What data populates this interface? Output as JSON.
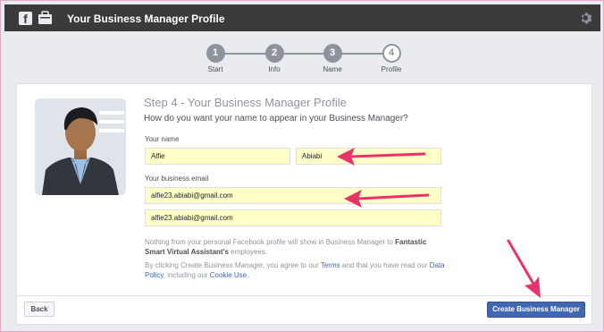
{
  "topbar": {
    "title": "Your Business Manager Profile",
    "fb_letter": "f",
    "icons": [
      "facebook-icon",
      "business-manager-icon",
      "gear-icon"
    ]
  },
  "steps": [
    {
      "number": "1",
      "label": "Start"
    },
    {
      "number": "2",
      "label": "Info"
    },
    {
      "number": "3",
      "label": "Name"
    },
    {
      "number": "4",
      "label": "Profile"
    }
  ],
  "profile": {
    "heading": "Step 4 - Your Business Manager Profile",
    "question": "How do you want your name to appear in your Business Manager?",
    "name_label": "Your name",
    "first_name": "Alfie",
    "last_name": "Abiabi",
    "email_label": "Your business email",
    "email": "alfie23.abiabi@gmail.com",
    "email_confirm": "alfie23.abiabi@gmail.com",
    "privacy_text_1": "Nothing from your personal Facebook profile will show in Business Manager to ",
    "privacy_business": "Fantastic Smart Virtual Assistant's",
    "privacy_text_2": " employees.",
    "terms_text_1": "By clicking Create Business Manager, you agree to our ",
    "terms_link": "Terms",
    "terms_text_2": " and that you have read our ",
    "data_policy_link": "Data Policy",
    "terms_text_3": ", including our ",
    "cookie_link": "Cookie Use",
    "terms_text_4": "."
  },
  "footer": {
    "back_label": "Back",
    "create_label": "Create Business Manager"
  },
  "colors": {
    "topbar": "#3a3a3a",
    "accent": "#4267b2",
    "field_highlight": "#ffffc8",
    "annotation_arrow": "#e8336a"
  }
}
